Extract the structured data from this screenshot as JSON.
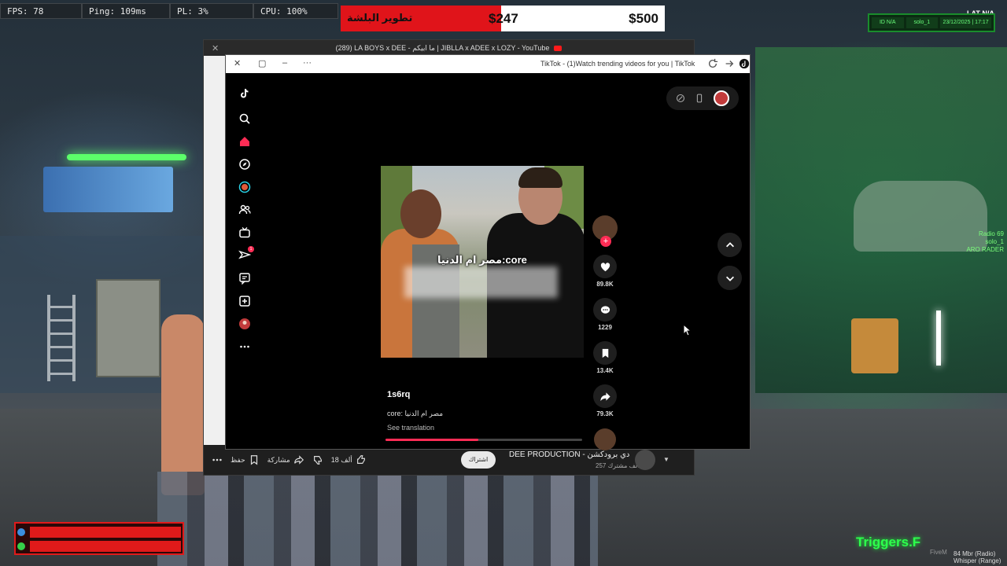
{
  "hud": {
    "fps": "FPS: 78",
    "ping": "Ping: 109ms",
    "pl": "PL: 3%",
    "cpu": "CPU: 100%"
  },
  "money": {
    "label": "تطوير البلشة",
    "current": "$247",
    "target": "$500",
    "progress_fraction": 0.494,
    "fill_color": "#e0141a"
  },
  "hud_right": {
    "id": "ID N/A",
    "player": "solo_1",
    "date": "23/12/2025 | 17:17",
    "lat": "LAT N/A",
    "radio_line1": "Radio 69",
    "radio_line2": "solo_1",
    "radio_line3": "ARO RADER"
  },
  "youtube": {
    "tab_title": "(289) LA BOYS x DEE - ما ابيكم | JIBLLA x ADEE x LOZY - YouTube",
    "likes": "18 ألف",
    "share": "مشاركة",
    "save": "حفظ",
    "subscribe": "اشتراك",
    "channel": "DEE PRODUCTION - دي برودكشن",
    "subscribers": "257 ألف مشترك"
  },
  "tiktok": {
    "title": "TikTok - (1)Watch trending videos for you | TikTok",
    "video_caption": "مصر ام الدنيا:core",
    "username": "1s6rq",
    "description": "core: مصر ام الدنيا",
    "translate": "See translation",
    "likes": "89.8K",
    "comments": "1229",
    "saves": "13.4K",
    "shares": "79.3K",
    "progress_fraction": 0.47,
    "accent": "#fe2c55",
    "sidebar_icons": [
      "tiktok-logo-icon",
      "search-icon",
      "home-icon",
      "explore-icon",
      "live-icon",
      "following-icon",
      "tv-icon",
      "messages-icon",
      "inbox-icon",
      "upload-icon",
      "profile-icon",
      "more-icon"
    ],
    "message_badge": "1"
  },
  "bottom_hud": {
    "triggers": "Triggers.F",
    "fivem": "FiveM",
    "whisper_line1": "84 Mbr (Radio)",
    "whisper_line2": "Whisper (Range)"
  }
}
